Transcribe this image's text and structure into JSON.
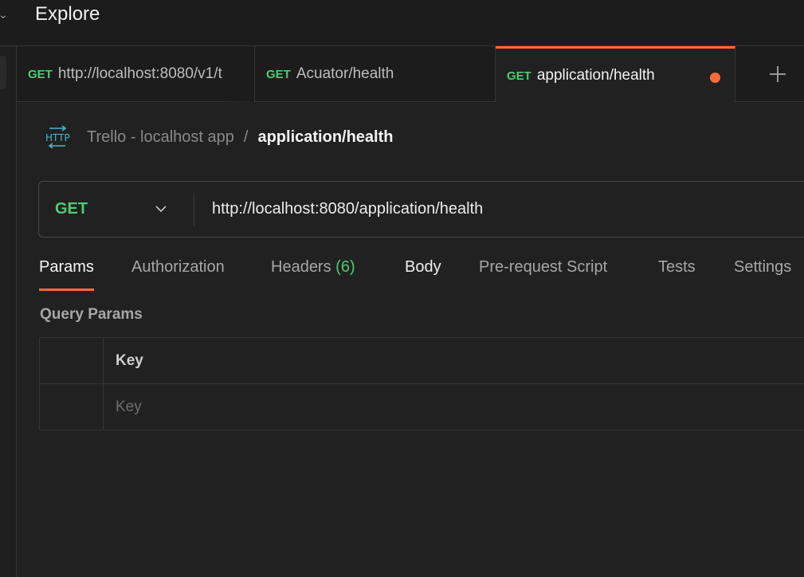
{
  "window": {
    "title": "Explore"
  },
  "tabs": [
    {
      "method": "GET",
      "name": "http://localhost:8080/v1/t",
      "active": false
    },
    {
      "method": "GET",
      "name": "Acuator/health",
      "active": false
    },
    {
      "method": "GET",
      "name": "application/health",
      "active": true,
      "unsaved": true
    }
  ],
  "breadcrumb": {
    "icon": "http-icon",
    "collection": "Trello - localhost app",
    "separator": "/",
    "request": "application/health"
  },
  "request": {
    "method": "GET",
    "url": "http://localhost:8080/application/health"
  },
  "request_tabs": {
    "params": "Params",
    "authorization": "Authorization",
    "headers": "Headers",
    "headers_count": "(6)",
    "body": "Body",
    "prerequest": "Pre-request Script",
    "tests": "Tests",
    "settings": "Settings"
  },
  "query_params": {
    "title": "Query Params",
    "column_key": "Key",
    "key_placeholder": "Key"
  },
  "colors": {
    "accent": "#ff6c37",
    "method_get": "#4ecb71",
    "background": "#212121"
  }
}
